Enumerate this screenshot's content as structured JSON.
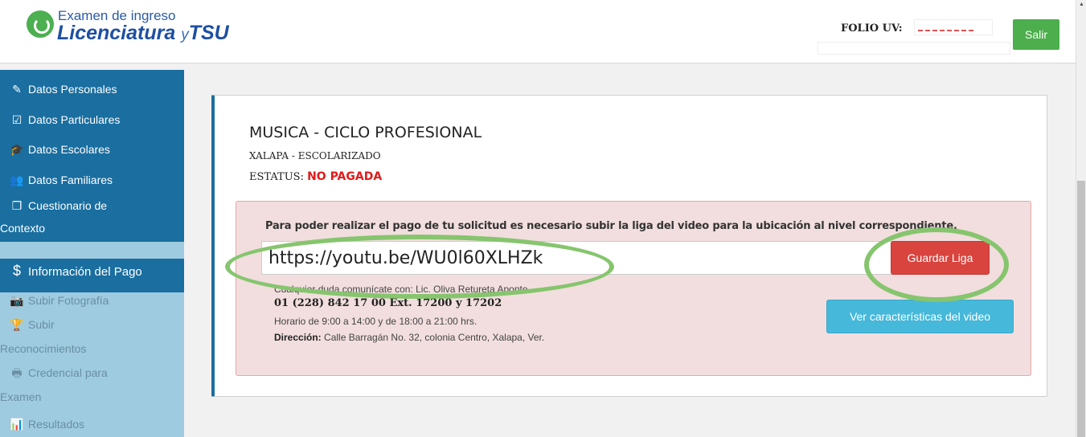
{
  "header": {
    "logo_line1": "Examen de ingreso",
    "logo_line2_a": "Licenciatura",
    "logo_line2_y": "y",
    "logo_line2_b": "TSU",
    "folio_label": "FOLIO UV:",
    "logout_label": "Salir"
  },
  "sidebar": {
    "items": [
      {
        "label": "Datos Personales",
        "icon": "pencil-icon"
      },
      {
        "label": "Datos Particulares",
        "icon": "edit-icon"
      },
      {
        "label": "Datos Escolares",
        "icon": "graduation-cap-icon"
      },
      {
        "label": "Datos Familiares",
        "icon": "users-icon"
      },
      {
        "label": "Cuestionario de",
        "label2": "Contexto",
        "icon": "documents-icon"
      },
      {
        "label": "Información del Pago",
        "icon": "dollar-icon"
      },
      {
        "label": "Subir Fotografía",
        "icon": "camera-icon"
      },
      {
        "label": "Subir",
        "label2": "Reconocimientos",
        "icon": "trophy-icon"
      },
      {
        "label": "Credencial para",
        "label2": "Examen",
        "icon": "print-icon"
      },
      {
        "label": "Resultados",
        "icon": "bar-chart-icon"
      }
    ]
  },
  "main": {
    "title": "MUSICA - CICLO PROFESIONAL",
    "subtitle": "XALAPA - ESCOLARIZADO",
    "status_label": "ESTATUS:",
    "status_value": "NO PAGADA",
    "alert": {
      "message": "Para poder realizar el pago de tu solicitud es necesario subir la liga del video para la ubicación al nivel correspondiente.",
      "url_value": "https://youtu.be/WU0l60XLHZk",
      "save_button": "Guardar Liga",
      "contact_line": "Cualquier duda comunícate con: Lic. Oliva Retureta Aponte",
      "phone": "01 (228) 842 17 00 Ext. 17200 y 17202",
      "hours": "Horario de 9:00 a 14:00 y de 18:00 a 21:00 hrs.",
      "address_label": "Dirección:",
      "address": "Calle Barragán No. 32, colonia Centro, Xalapa, Ver.",
      "video_button": "Ver características del video"
    }
  },
  "colors": {
    "primary_blue": "#1a6ea0",
    "danger_red": "#d9443f",
    "info_blue": "#46b8da",
    "success_green": "#4cae4c",
    "highlight_green": "#86c56e"
  }
}
